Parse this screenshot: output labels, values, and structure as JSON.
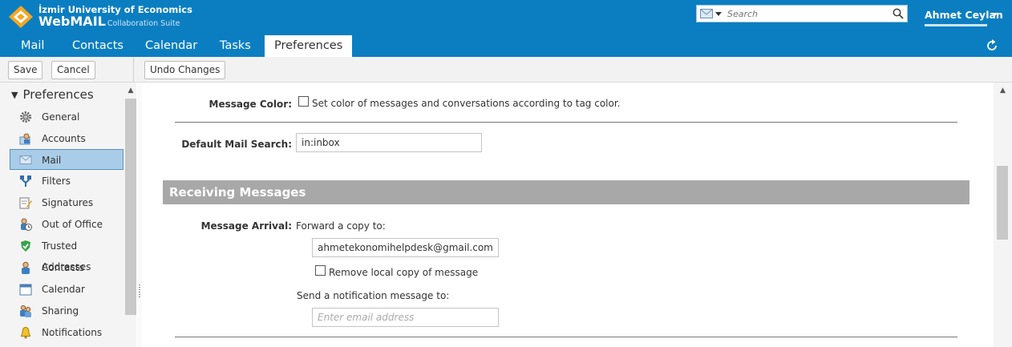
{
  "header": {
    "org_name": "İzmir University of Economics",
    "app_name": "WebMAIL",
    "app_sub": "Collaboration Suite",
    "search_placeholder": "Search",
    "user_name": "Ahmet Ceylan",
    "brand_color": "#0b7ec1"
  },
  "tabs": [
    {
      "label": "Mail"
    },
    {
      "label": "Contacts"
    },
    {
      "label": "Calendar"
    },
    {
      "label": "Tasks"
    },
    {
      "label": "Preferences",
      "active": true
    }
  ],
  "toolbar": {
    "save_label": "Save",
    "cancel_label": "Cancel",
    "undo_label": "Undo Changes"
  },
  "sidebar": {
    "title": "Preferences",
    "items": [
      {
        "label": "General",
        "icon": "gear-icon"
      },
      {
        "label": "Accounts",
        "icon": "accounts-icon"
      },
      {
        "label": "Mail",
        "icon": "envelope-icon",
        "selected": true
      },
      {
        "label": "Filters",
        "icon": "filter-icon"
      },
      {
        "label": "Signatures",
        "icon": "signature-icon"
      },
      {
        "label": "Out of Office",
        "icon": "out-of-office-icon"
      },
      {
        "label": "Trusted Addresses",
        "icon": "shield-icon"
      },
      {
        "label": "Contacts",
        "icon": "contact-icon"
      },
      {
        "label": "Calendar",
        "icon": "calendar-icon"
      },
      {
        "label": "Sharing",
        "icon": "sharing-icon"
      },
      {
        "label": "Notifications",
        "icon": "bell-icon"
      }
    ]
  },
  "main": {
    "message_color_label": "Message Color:",
    "message_color_text": "Set color of messages and conversations according to tag color.",
    "default_search_label": "Default Mail Search:",
    "default_search_value": "in:inbox",
    "receiving_section": "Receiving Messages",
    "message_arrival_label": "Message Arrival:",
    "forward_label": "Forward a copy to:",
    "forward_value": "ahmetekonomihelpdesk@gmail.com",
    "remove_local_label": "Remove local copy of message",
    "notify_label": "Send a notification message to:",
    "notify_placeholder": "Enter email address"
  }
}
